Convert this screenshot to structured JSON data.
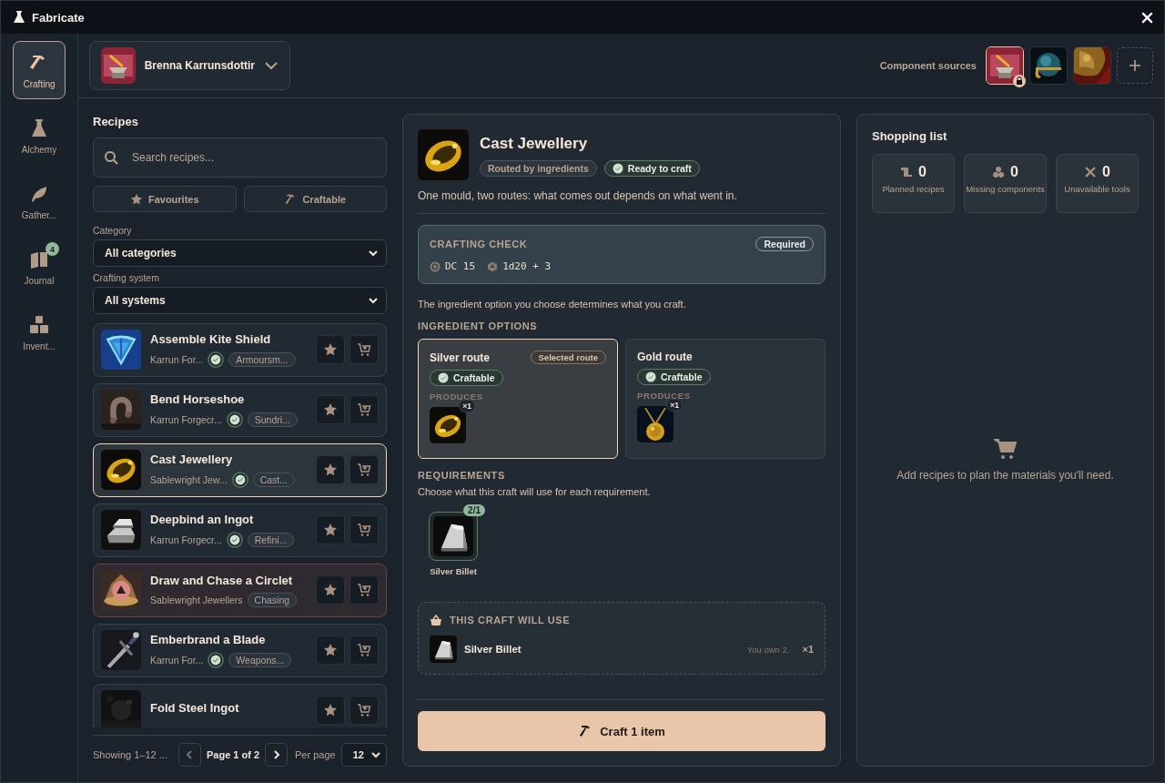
{
  "window": {
    "title": "Fabricate"
  },
  "nav": [
    {
      "label": "Crafting",
      "selected": true
    },
    {
      "label": "Alchemy",
      "selected": false
    },
    {
      "label": "Gather...",
      "selected": false
    },
    {
      "label": "Journal",
      "selected": false,
      "badge": "4"
    },
    {
      "label": "Invent...",
      "selected": false
    }
  ],
  "character": {
    "name": "Brenna Karrunsdottir"
  },
  "component_sources": {
    "label": "Component sources",
    "sources": [
      {
        "selected": true,
        "locked": true
      },
      {
        "selected": false,
        "locked": false
      },
      {
        "selected": false,
        "locked": false
      }
    ]
  },
  "recipes": {
    "title": "Recipes",
    "search": {
      "placeholder": "Search recipes..."
    },
    "filters": [
      {
        "label": "Favourites",
        "on": false
      },
      {
        "label": "Craftable",
        "on": false
      }
    ],
    "category": {
      "label": "Category",
      "value": "All categories"
    },
    "system": {
      "label": "Crafting system",
      "value": "All systems"
    },
    "items": [
      {
        "name": "Assemble Kite Shield",
        "source": "Karrun For...",
        "category": "Armoursm...",
        "craftable": true,
        "selected": false
      },
      {
        "name": "Bend Horseshoe",
        "source": "Karrun Forgecr...",
        "category": "Sundri...",
        "craftable": true,
        "selected": false
      },
      {
        "name": "Cast Jewellery",
        "source": "Sablewright Jew...",
        "category": "Cast...",
        "craftable": true,
        "selected": true
      },
      {
        "name": "Deepbind an Ingot",
        "source": "Karrun Forgecr...",
        "category": "Refini...",
        "craftable": true,
        "selected": false
      },
      {
        "name": "Draw and Chase a Circlet",
        "source": "Sablewright Jewellers",
        "category": "Chasing",
        "craftable": false,
        "selected": false
      },
      {
        "name": "Emberbrand a Blade",
        "source": "Karrun For...",
        "category": "Weapons...",
        "craftable": true,
        "selected": false
      },
      {
        "name": "Fold Steel Ingot",
        "craftable": true,
        "selected": false
      }
    ],
    "footer": {
      "showing": "Showing 1–12 ...",
      "page": "Page 1 of 2",
      "per_page_label": "Per page",
      "per_page": "12"
    }
  },
  "detail": {
    "title": "Cast Jewellery",
    "tags": [
      {
        "label": "Routed by ingredients",
        "kind": "plain"
      },
      {
        "label": "Ready to craft",
        "kind": "ready"
      }
    ],
    "description": "One mould, two routes: what comes out depends on what went in.",
    "check": {
      "title": "CRAFTING CHECK",
      "badge": "Required",
      "dc": "DC 15",
      "roll": "1d20 + 3"
    },
    "options_note": "The ingredient option you choose determines what you craft.",
    "options_title": "INGREDIENT OPTIONS",
    "options": [
      {
        "name": "Silver route",
        "selected": true,
        "badge": "Selected route",
        "status": "Craftable",
        "produces_label": "PRODUCES",
        "qty": "×1"
      },
      {
        "name": "Gold route",
        "selected": false,
        "status": "Craftable",
        "produces_label": "PRODUCES",
        "qty": "×1"
      }
    ],
    "requirements": {
      "title": "REQUIREMENTS",
      "note": "Choose what this craft will use for each requirement.",
      "items": [
        {
          "name": "Silver Billet",
          "count": "2/1"
        }
      ]
    },
    "usage": {
      "title": "THIS CRAFT WILL USE",
      "items": [
        {
          "name": "Silver Billet",
          "owned": "You own 2.",
          "qty": "×1"
        }
      ]
    },
    "craft_button": "Craft 1 item"
  },
  "shopping": {
    "title": "Shopping list",
    "stats": [
      {
        "value": "0",
        "label": "Planned recipes"
      },
      {
        "value": "0",
        "label": "Missing components"
      },
      {
        "value": "0",
        "label": "Unavailable tools"
      }
    ],
    "empty": "Add recipes to plan the materials you'll need."
  }
}
